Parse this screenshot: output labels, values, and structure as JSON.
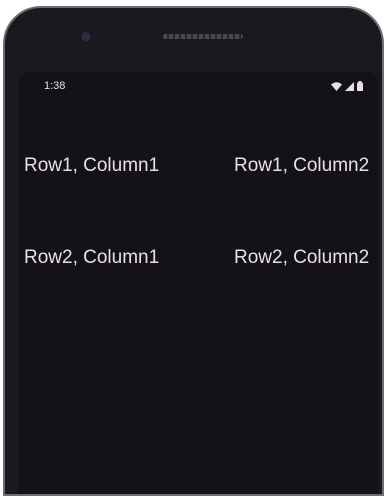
{
  "status_bar": {
    "time": "1:38",
    "icons": [
      "wifi-icon",
      "signal-icon",
      "battery-icon"
    ]
  },
  "grid": {
    "rows": [
      {
        "cells": [
          "Row1, Column1",
          "Row1, Column2"
        ]
      },
      {
        "cells": [
          "Row2, Column1",
          "Row2, Column2"
        ]
      }
    ]
  },
  "colors": {
    "screen_background": "#141218",
    "text": "#e6e1e5",
    "device_frame": "#1a191d"
  }
}
